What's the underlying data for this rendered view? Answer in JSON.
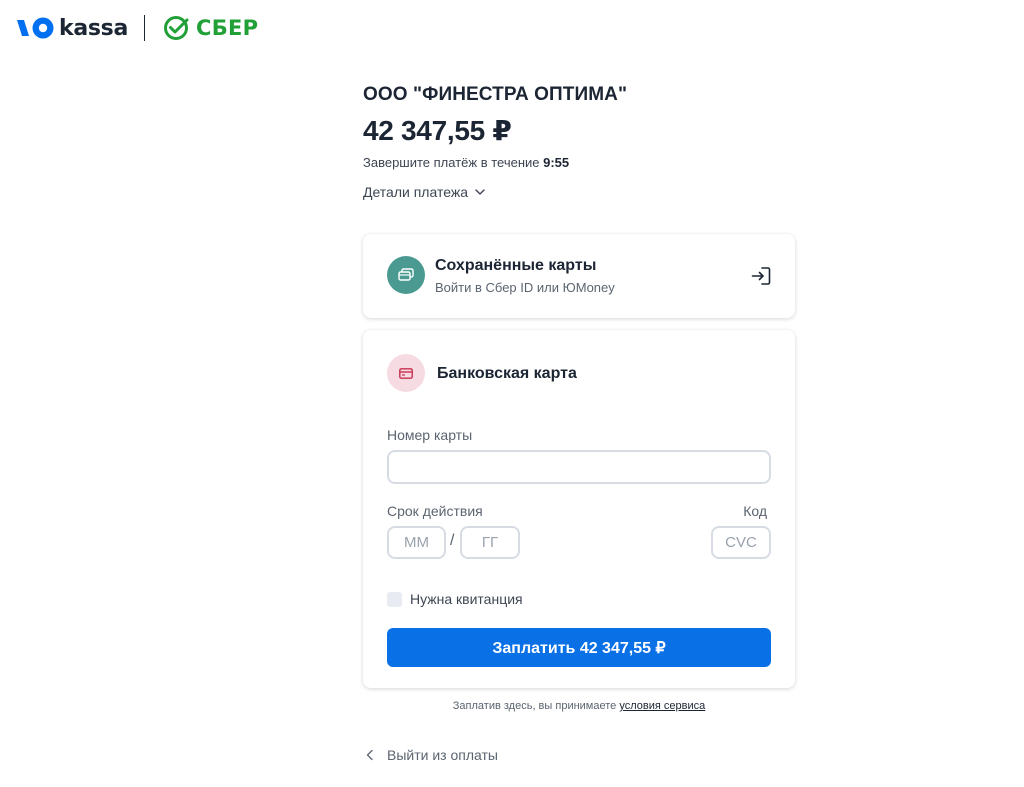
{
  "header": {
    "yoo_brand": "kassa",
    "sber_brand": "СБЕР",
    "colors": {
      "yoo": "#0070f0",
      "sber": "#21a038"
    }
  },
  "summary": {
    "merchant": "ООО \"ФИНЕСТРА ОПТИМА\"",
    "amount": "42 347,55 ₽",
    "timer_prefix": "Завершите платёж в течение ",
    "timer_value": "9:55",
    "details_label": "Детали платежа"
  },
  "saved_cards": {
    "title": "Сохранённые карты",
    "subtitle": "Войти в Сбер ID или ЮMoney",
    "icon": "saved-cards-icon",
    "icon_color": "#4a9a92"
  },
  "bank_card": {
    "title": "Банковская карта",
    "icon": "bank-card-icon",
    "icon_color": "#f7dbe2",
    "card_number_label": "Номер карты",
    "card_number_value": "",
    "expiry_label": "Срок действия",
    "month_placeholder": "ММ",
    "year_placeholder": "ГГ",
    "code_label": "Код",
    "code_placeholder": "CVC",
    "receipt_label": "Нужна квитанция",
    "receipt_checked": false,
    "pay_label": "Заплатить 42 347,55 ₽",
    "pay_color": "#0970e6"
  },
  "terms": {
    "prefix": "Заплатив здесь, вы принимаете ",
    "link": "условия сервиса"
  },
  "exit_label": "Выйти из оплаты"
}
